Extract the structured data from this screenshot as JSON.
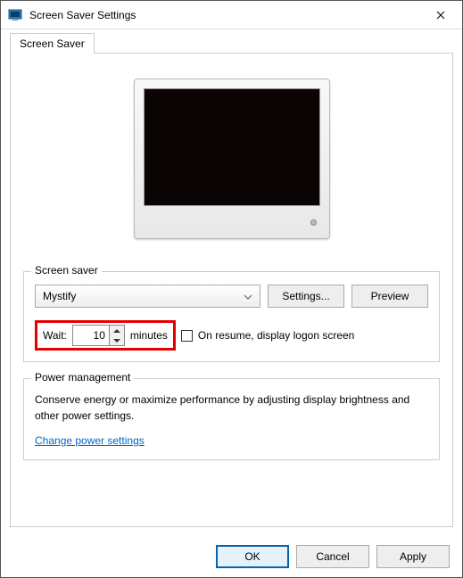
{
  "window": {
    "title": "Screen Saver Settings"
  },
  "tabs": {
    "screen_saver": "Screen Saver"
  },
  "group": {
    "screensaver_label": "Screen saver",
    "power_label": "Power management"
  },
  "dropdown": {
    "selected": "Mystify"
  },
  "buttons": {
    "settings": "Settings...",
    "preview": "Preview",
    "ok": "OK",
    "cancel": "Cancel",
    "apply": "Apply"
  },
  "wait": {
    "label": "Wait:",
    "value": "10",
    "unit": "minutes",
    "resume_label": "On resume, display logon screen"
  },
  "power": {
    "text": "Conserve energy or maximize performance by adjusting display brightness and other power settings.",
    "link": "Change power settings"
  }
}
